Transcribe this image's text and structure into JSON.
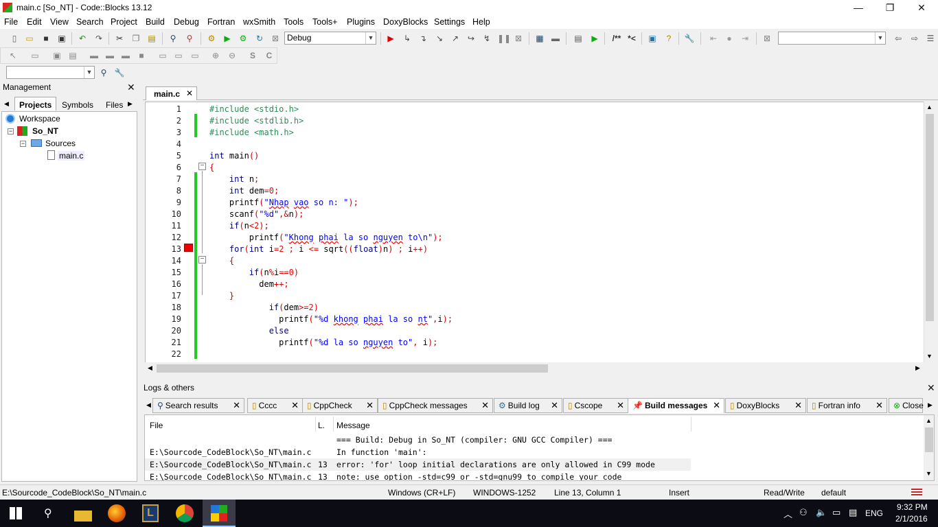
{
  "window": {
    "title": "main.c [So_NT] - Code::Blocks 13.12",
    "minimize": "—",
    "maximize": "❐",
    "close": "✕"
  },
  "menu": [
    "File",
    "Edit",
    "View",
    "Search",
    "Project",
    "Build",
    "Debug",
    "Fortran",
    "wxSmith",
    "Tools",
    "Tools+",
    "Plugins",
    "DoxyBlocks",
    "Settings",
    "Help"
  ],
  "toolbar": {
    "build_target": "Debug",
    "doxy_comment": "/**",
    "doxy_line": "*<",
    "search_combo": ""
  },
  "management": {
    "title": "Management",
    "close": "✕",
    "tabs": [
      "Projects",
      "Symbols",
      "Files"
    ]
  },
  "tree": {
    "workspace": "Workspace",
    "project": "So_NT",
    "folder": "Sources",
    "file": "main.c"
  },
  "editor": {
    "tab": "main.c",
    "tab_close": "✕",
    "lines": [
      {
        "n": "1"
      },
      {
        "n": "2"
      },
      {
        "n": "3"
      },
      {
        "n": "4"
      },
      {
        "n": "5"
      },
      {
        "n": "6"
      },
      {
        "n": "7"
      },
      {
        "n": "8"
      },
      {
        "n": "9"
      },
      {
        "n": "10"
      },
      {
        "n": "11"
      },
      {
        "n": "12"
      },
      {
        "n": "13"
      },
      {
        "n": "14"
      },
      {
        "n": "15"
      },
      {
        "n": "16"
      },
      {
        "n": "17"
      },
      {
        "n": "18"
      },
      {
        "n": "19"
      },
      {
        "n": "20"
      },
      {
        "n": "21"
      },
      {
        "n": "22"
      }
    ]
  },
  "logs": {
    "title": "Logs & others",
    "close": "✕",
    "tabs": [
      {
        "label": "Search results",
        "icon": "search-icon"
      },
      {
        "label": "Cccc",
        "icon": "document-icon"
      },
      {
        "label": "CppCheck",
        "icon": "document-icon"
      },
      {
        "label": "CppCheck messages",
        "icon": "document-icon"
      },
      {
        "label": "Build log",
        "icon": "gear-icon"
      },
      {
        "label": "Cscope",
        "icon": "document-icon"
      },
      {
        "label": "Build messages",
        "icon": "pin-icon",
        "active": true
      },
      {
        "label": "DoxyBlocks",
        "icon": "document-icon"
      },
      {
        "label": "Fortran info",
        "icon": "document-icon"
      },
      {
        "label": "Close",
        "icon": "close-icon"
      }
    ],
    "headers": {
      "file": "File",
      "line": "L.",
      "message": "Message"
    },
    "rows": [
      {
        "file": "",
        "line": "",
        "message": "=== Build: Debug in So_NT (compiler: GNU GCC Compiler) ==="
      },
      {
        "file": "E:\\Sourcode_CodeBlock\\So_NT\\main.c",
        "line": "",
        "message": "In function 'main':"
      },
      {
        "file": "E:\\Sourcode_CodeBlock\\So_NT\\main.c",
        "line": "13",
        "message": "error: 'for' loop initial declarations are only allowed in C99 mode"
      },
      {
        "file": "E:\\Sourcode_CodeBlock\\So_NT\\main.c",
        "line": "13",
        "message": "note: use option -std=c99 or -std=gnu99 to compile your code"
      }
    ]
  },
  "status": {
    "path": "E:\\Sourcode_CodeBlock\\So_NT\\main.c",
    "eol": "Windows (CR+LF)",
    "encoding": "WINDOWS-1252",
    "position": "Line 13, Column 1",
    "mode": "Insert",
    "access": "Read/Write",
    "profile": "default"
  },
  "taskbar": {
    "lang": "ENG",
    "time": "9:32 PM",
    "date": "2/1/2016"
  },
  "colors": {
    "changebar": "#22cc22",
    "error_marker": "#e00000",
    "preprocessor": "#2e8b57",
    "keyword": "#00008b",
    "string": "#0000ff"
  }
}
